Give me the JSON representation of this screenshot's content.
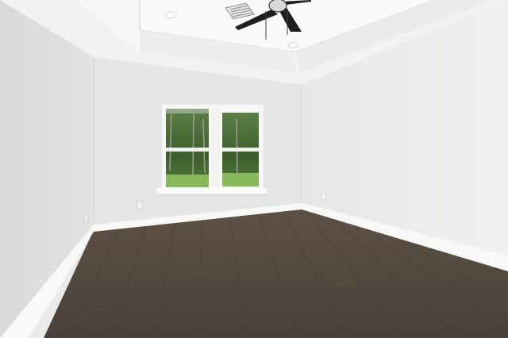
{
  "scene": {
    "type": "empty-room-interior",
    "features": [
      "tray-ceiling",
      "ceiling-fan",
      "recessed-lights",
      "hvac-vent",
      "double-window",
      "baseboards",
      "wood-plank-floor",
      "wall-outlets"
    ],
    "colors": {
      "ceiling": "#f4f4f3",
      "left_wall": "#dcdddd",
      "back_wall": "#e6e7e6",
      "right_wall": "#ebebea",
      "floor": "#54493f",
      "trim": "#fbfbfa",
      "foliage": "#3f6a2e",
      "grass": "#7fb354",
      "fan": "#1e1e1e"
    }
  }
}
